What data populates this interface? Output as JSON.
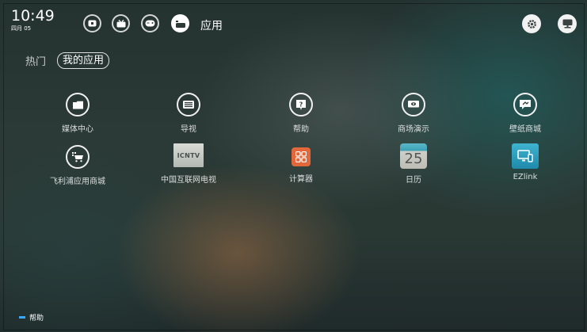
{
  "status": {
    "time": "10:49",
    "date": "四月 05"
  },
  "topbar": {
    "icons": [
      "tv-icon",
      "media-icon",
      "gamepad-icon",
      "apps-icon"
    ],
    "active_label": "应用",
    "right_icons": [
      "settings-icon",
      "network-icon"
    ]
  },
  "tabs": {
    "hot": "热门",
    "my_apps": "我的应用"
  },
  "apps": [
    {
      "label": "媒体中心",
      "icon": "folder-icon"
    },
    {
      "label": "导视",
      "icon": "keyboard-icon"
    },
    {
      "label": "帮助",
      "icon": "help-icon"
    },
    {
      "label": "商场演示",
      "icon": "demo-icon"
    },
    {
      "label": "壁纸商城",
      "icon": "wallpaper-icon"
    },
    {
      "label": "飞利浦应用商城",
      "icon": "cart-icon"
    },
    {
      "label": "中国互联网电视",
      "icon": "ichtv-logo",
      "logo_text": "ICNTV"
    },
    {
      "label": "计算器",
      "icon": "calculator-icon"
    },
    {
      "label": "日历",
      "icon": "calendar-icon",
      "day": "25"
    },
    {
      "label": "EZlink",
      "icon": "ezlink-icon"
    }
  ],
  "footer": {
    "help": "帮助"
  },
  "colors": {
    "accent": "#39a8ff",
    "calc": "#e2683b",
    "calendar": "#3aa0b5",
    "ezlink": "#2b9fc0"
  }
}
